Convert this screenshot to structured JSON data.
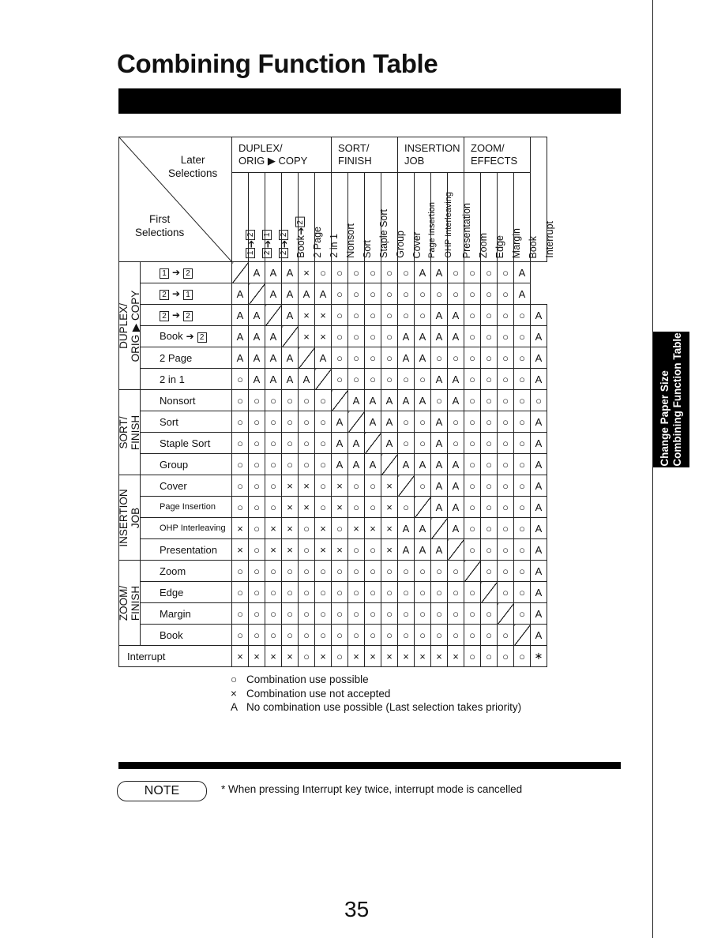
{
  "title": "Combining Function Table",
  "side_tab": {
    "line1": "Change Paper Size",
    "line2": "Combining Function Table"
  },
  "corner": {
    "later_line1": "Later",
    "later_line2": "Selections",
    "first_line1": "First",
    "first_line2": "Selections"
  },
  "column_groups": [
    {
      "line1": "DUPLEX/",
      "line2": "ORIG ▶ COPY",
      "span": 6
    },
    {
      "line1": "SORT/",
      "line2": "FINISH",
      "span": 4
    },
    {
      "line1": "INSERTION",
      "line2": "JOB",
      "span": 4
    },
    {
      "line1": "ZOOM/",
      "line2": "EFFECTS",
      "span": 4
    }
  ],
  "columns": [
    {
      "label": "1→2",
      "kind": "duplex",
      "from": "1",
      "to": "2"
    },
    {
      "label": "2→1",
      "kind": "duplex",
      "from": "2",
      "to": "1"
    },
    {
      "label": "2→2",
      "kind": "duplex",
      "from": "2",
      "to": "2"
    },
    {
      "label": "Book→2",
      "kind": "book",
      "from": "Book",
      "to": "2"
    },
    {
      "label": "2 Page",
      "kind": "text"
    },
    {
      "label": "2 in 1",
      "kind": "text"
    },
    {
      "label": "Nonsort",
      "kind": "text"
    },
    {
      "label": "Sort",
      "kind": "text"
    },
    {
      "label": "Staple Sort",
      "kind": "text"
    },
    {
      "label": "Group",
      "kind": "text"
    },
    {
      "label": "Cover",
      "kind": "text"
    },
    {
      "label": "Page Insertion",
      "kind": "small"
    },
    {
      "label": "OHP Interleaving",
      "kind": "small"
    },
    {
      "label": "Presentation",
      "kind": "text"
    },
    {
      "label": "Zoom",
      "kind": "text"
    },
    {
      "label": "Edge",
      "kind": "text"
    },
    {
      "label": "Margin",
      "kind": "text"
    },
    {
      "label": "Book",
      "kind": "text"
    },
    {
      "label": "Interrupt",
      "kind": "text"
    }
  ],
  "sections": [
    {
      "line1": "DUPLEX/",
      "line2": "ORIG ▶ COPY",
      "rows": [
        {
          "label": "1→2",
          "kind": "duplex",
          "from": "1",
          "to": "2",
          "cells": [
            "\\",
            "A",
            "A",
            "A",
            "X",
            "O",
            "O",
            "O",
            "O",
            "O",
            "O",
            "A",
            "A",
            "O",
            "O",
            "O",
            "O",
            "A"
          ]
        },
        {
          "label": "2→1",
          "kind": "duplex",
          "from": "2",
          "to": "1",
          "cells": [
            "A",
            "\\",
            "A",
            "A",
            "A",
            "A",
            "O",
            "O",
            "O",
            "O",
            "O",
            "O",
            "O",
            "O",
            "O",
            "O",
            "O",
            "A"
          ]
        },
        {
          "label": "2→2",
          "kind": "duplex",
          "from": "2",
          "to": "2",
          "cells": [
            "A",
            "A",
            "\\",
            "A",
            "X",
            "X",
            "O",
            "O",
            "O",
            "O",
            "O",
            "O",
            "A",
            "A",
            "O",
            "O",
            "O",
            "O",
            "A"
          ]
        },
        {
          "label": "Book→2",
          "kind": "book",
          "from": "Book",
          "to": "2",
          "cells": [
            "A",
            "A",
            "A",
            "\\",
            "X",
            "X",
            "O",
            "O",
            "O",
            "O",
            "A",
            "A",
            "A",
            "A",
            "O",
            "O",
            "O",
            "O",
            "A"
          ]
        },
        {
          "label": "2 Page",
          "kind": "text",
          "cells": [
            "A",
            "A",
            "A",
            "A",
            "\\",
            "A",
            "O",
            "O",
            "O",
            "O",
            "A",
            "A",
            "O",
            "O",
            "O",
            "O",
            "O",
            "O",
            "A"
          ]
        },
        {
          "label": "2 in 1",
          "kind": "text",
          "cells": [
            "O",
            "A",
            "A",
            "A",
            "A",
            "\\",
            "O",
            "O",
            "O",
            "O",
            "O",
            "O",
            "A",
            "A",
            "O",
            "O",
            "O",
            "O",
            "A"
          ]
        }
      ]
    },
    {
      "line1": "SORT/",
      "line2": "FINISH",
      "rows": [
        {
          "label": "Nonsort",
          "kind": "text",
          "cells": [
            "O",
            "O",
            "O",
            "O",
            "O",
            "O",
            "\\",
            "A",
            "A",
            "A",
            "A",
            "A",
            "O",
            "A",
            "O",
            "O",
            "O",
            "O",
            "O"
          ]
        },
        {
          "label": "Sort",
          "kind": "text",
          "cells": [
            "O",
            "O",
            "O",
            "O",
            "O",
            "O",
            "A",
            "\\",
            "A",
            "A",
            "O",
            "O",
            "A",
            "O",
            "O",
            "O",
            "O",
            "O",
            "A"
          ]
        },
        {
          "label": "Staple Sort",
          "kind": "text",
          "cells": [
            "O",
            "O",
            "O",
            "O",
            "O",
            "O",
            "A",
            "A",
            "\\",
            "A",
            "O",
            "O",
            "A",
            "O",
            "O",
            "O",
            "O",
            "O",
            "A"
          ]
        },
        {
          "label": "Group",
          "kind": "text",
          "cells": [
            "O",
            "O",
            "O",
            "O",
            "O",
            "O",
            "A",
            "A",
            "A",
            "\\",
            "A",
            "A",
            "A",
            "A",
            "O",
            "O",
            "O",
            "O",
            "A"
          ]
        }
      ]
    },
    {
      "line1": "INSERTION",
      "line2": "JOB",
      "rows": [
        {
          "label": "Cover",
          "kind": "text",
          "cells": [
            "O",
            "O",
            "O",
            "X",
            "X",
            "O",
            "X",
            "O",
            "O",
            "X",
            "\\",
            "O",
            "A",
            "A",
            "O",
            "O",
            "O",
            "O",
            "A"
          ]
        },
        {
          "label": "Page Insertion",
          "kind": "small",
          "cells": [
            "O",
            "O",
            "O",
            "X",
            "X",
            "O",
            "X",
            "O",
            "O",
            "X",
            "O",
            "\\",
            "A",
            "A",
            "O",
            "O",
            "O",
            "O",
            "A"
          ]
        },
        {
          "label": "OHP Interleaving",
          "kind": "small",
          "cells": [
            "X",
            "O",
            "X",
            "X",
            "O",
            "X",
            "O",
            "X",
            "X",
            "X",
            "A",
            "A",
            "\\",
            "A",
            "O",
            "O",
            "O",
            "O",
            "A"
          ]
        },
        {
          "label": "Presentation",
          "kind": "text",
          "cells": [
            "X",
            "O",
            "X",
            "X",
            "O",
            "X",
            "X",
            "O",
            "O",
            "X",
            "A",
            "A",
            "A",
            "\\",
            "O",
            "O",
            "O",
            "O",
            "A"
          ]
        }
      ]
    },
    {
      "line1": "ZOOM/",
      "line2": "FINISH",
      "rows": [
        {
          "label": "Zoom",
          "kind": "text",
          "cells": [
            "O",
            "O",
            "O",
            "O",
            "O",
            "O",
            "O",
            "O",
            "O",
            "O",
            "O",
            "O",
            "O",
            "O",
            "\\",
            "O",
            "O",
            "O",
            "A"
          ]
        },
        {
          "label": "Edge",
          "kind": "text",
          "cells": [
            "O",
            "O",
            "O",
            "O",
            "O",
            "O",
            "O",
            "O",
            "O",
            "O",
            "O",
            "O",
            "O",
            "O",
            "O",
            "\\",
            "O",
            "O",
            "A"
          ]
        },
        {
          "label": "Margin",
          "kind": "text",
          "cells": [
            "O",
            "O",
            "O",
            "O",
            "O",
            "O",
            "O",
            "O",
            "O",
            "O",
            "O",
            "O",
            "O",
            "O",
            "O",
            "O",
            "\\",
            "O",
            "A"
          ]
        },
        {
          "label": "Book",
          "kind": "text",
          "cells": [
            "O",
            "O",
            "O",
            "O",
            "O",
            "O",
            "O",
            "O",
            "O",
            "O",
            "O",
            "O",
            "O",
            "O",
            "O",
            "O",
            "O",
            "\\",
            "A"
          ]
        }
      ]
    }
  ],
  "interrupt_row": {
    "label": "Interrupt",
    "cells": [
      "X",
      "X",
      "X",
      "X",
      "O",
      "X",
      "O",
      "X",
      "X",
      "X",
      "X",
      "X",
      "X",
      "X",
      "O",
      "O",
      "O",
      "O",
      "*"
    ]
  },
  "legend": [
    {
      "symbol": "O",
      "text": "Combination use possible"
    },
    {
      "symbol": "X",
      "text": "Combination use not accepted"
    },
    {
      "symbol": "A",
      "text": "No combination use possible  (Last selection takes priority)"
    }
  ],
  "note": {
    "label": "NOTE",
    "text": "* When pressing Interrupt key twice, interrupt mode is cancelled"
  },
  "page_number": "35"
}
